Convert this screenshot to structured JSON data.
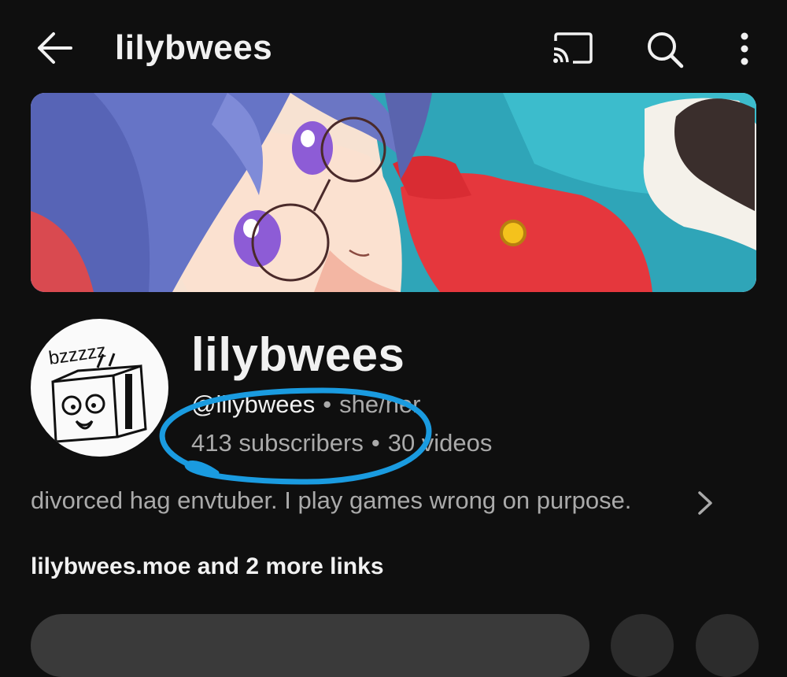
{
  "header": {
    "title": "lilybwees",
    "back_icon": "arrow-left-icon",
    "cast_icon": "cast-icon",
    "search_icon": "search-icon",
    "more_icon": "more-vertical-icon"
  },
  "channel": {
    "name": "lilybwees",
    "handle": "@lilybwees",
    "pronouns": "she/her",
    "subscribers": "413 subscribers",
    "videos": "30 videos",
    "separator": "•",
    "description": "divorced hag envtuber. I play games wrong on purpose.",
    "links": "lilybwees.moe and 2 more links",
    "avatar_text": "bzzzzz"
  },
  "colors": {
    "background": "#0f0f0f",
    "primary_text": "#f1f1f1",
    "secondary_text": "#aaaaaa",
    "annotation_stroke": "#1a9be0"
  }
}
